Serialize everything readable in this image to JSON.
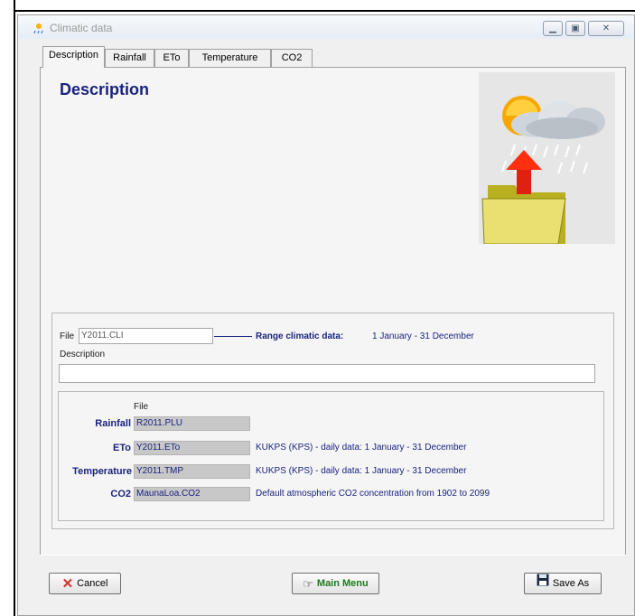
{
  "window": {
    "title": "Climatic data"
  },
  "tabs": [
    {
      "label": "Description"
    },
    {
      "label": "Rainfall"
    },
    {
      "label": "ETo"
    },
    {
      "label": "Temperature"
    },
    {
      "label": "CO2"
    }
  ],
  "page": {
    "title": "Description"
  },
  "file": {
    "label": "File",
    "value": "Y2011.CLI",
    "range_label": "Range climatic data:",
    "range_value": "1 January - 31 December",
    "description_label": "Description",
    "description_value": ""
  },
  "files_table": {
    "header": "File",
    "rows": [
      {
        "label": "Rainfall",
        "file": "R2011.PLU",
        "info": ""
      },
      {
        "label": "ETo",
        "file": "Y2011.ETo",
        "info": "KUKPS (KPS) - daily data: 1 January - 31 December"
      },
      {
        "label": "Temperature",
        "file": "Y2011.TMP",
        "info": "KUKPS (KPS) - daily data: 1 January - 31 December"
      },
      {
        "label": "CO2",
        "file": "MaunaLoa.CO2",
        "info": "Default atmospheric CO2 concentration from 1902 to 2099"
      }
    ]
  },
  "buttons": {
    "cancel": "Cancel",
    "main_menu": "Main Menu",
    "save_as": "Save As"
  },
  "icons": {
    "app": "climate-icon",
    "cancel": "red-x-icon",
    "main_menu": "pointing-hand-icon",
    "save_as": "floppy-disk-icon",
    "picture": "weather-folder-icon"
  },
  "colors": {
    "accent": "#1a237e",
    "cancel_icon": "#d32f2f",
    "main_menu_text": "#1b7a1b"
  }
}
